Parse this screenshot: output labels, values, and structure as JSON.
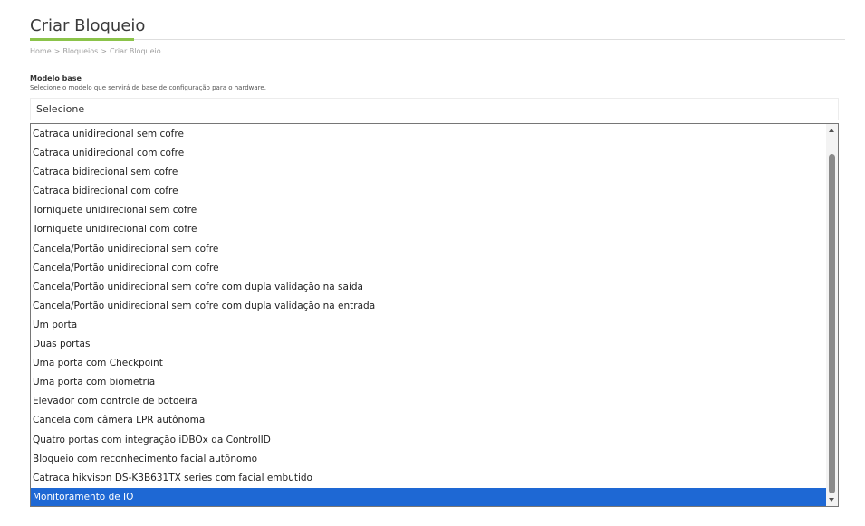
{
  "page": {
    "title": "Criar Bloqueio",
    "breadcrumb": [
      "Home",
      ">",
      "Bloqueios",
      ">",
      "Criar Bloqueio"
    ]
  },
  "form": {
    "label": "Modelo base",
    "help": "Selecione o modelo que servirá de base de configuração para o hardware.",
    "select_value": "Selecione",
    "options": [
      "Catraca unidirecional sem cofre",
      "Catraca unidirecional com cofre",
      "Catraca bidirecional sem cofre",
      "Catraca bidirecional com cofre",
      "Torniquete unidirecional sem cofre",
      "Torniquete unidirecional com cofre",
      "Cancela/Portão unidirecional sem cofre",
      "Cancela/Portão unidirecional com cofre",
      "Cancela/Portão unidirecional sem cofre com dupla validação na saída",
      "Cancela/Portão unidirecional sem cofre com dupla validação na entrada",
      "Um porta",
      "Duas portas",
      "Uma porta com Checkpoint",
      "Uma porta com biometria",
      "Elevador com controle de botoeira",
      "Cancela com câmera LPR autônoma",
      "Quatro portas com integração iDBOx da ControlID",
      "Bloqueio com reconhecimento facial autônomo",
      "Catraca hikvison DS-K3B631TX series com facial embutido",
      "Monitoramento de IO"
    ],
    "highlighted_option": "Monitoramento de IO"
  },
  "colors": {
    "accent": "#8bc34a",
    "selection": "#1e68d4"
  }
}
